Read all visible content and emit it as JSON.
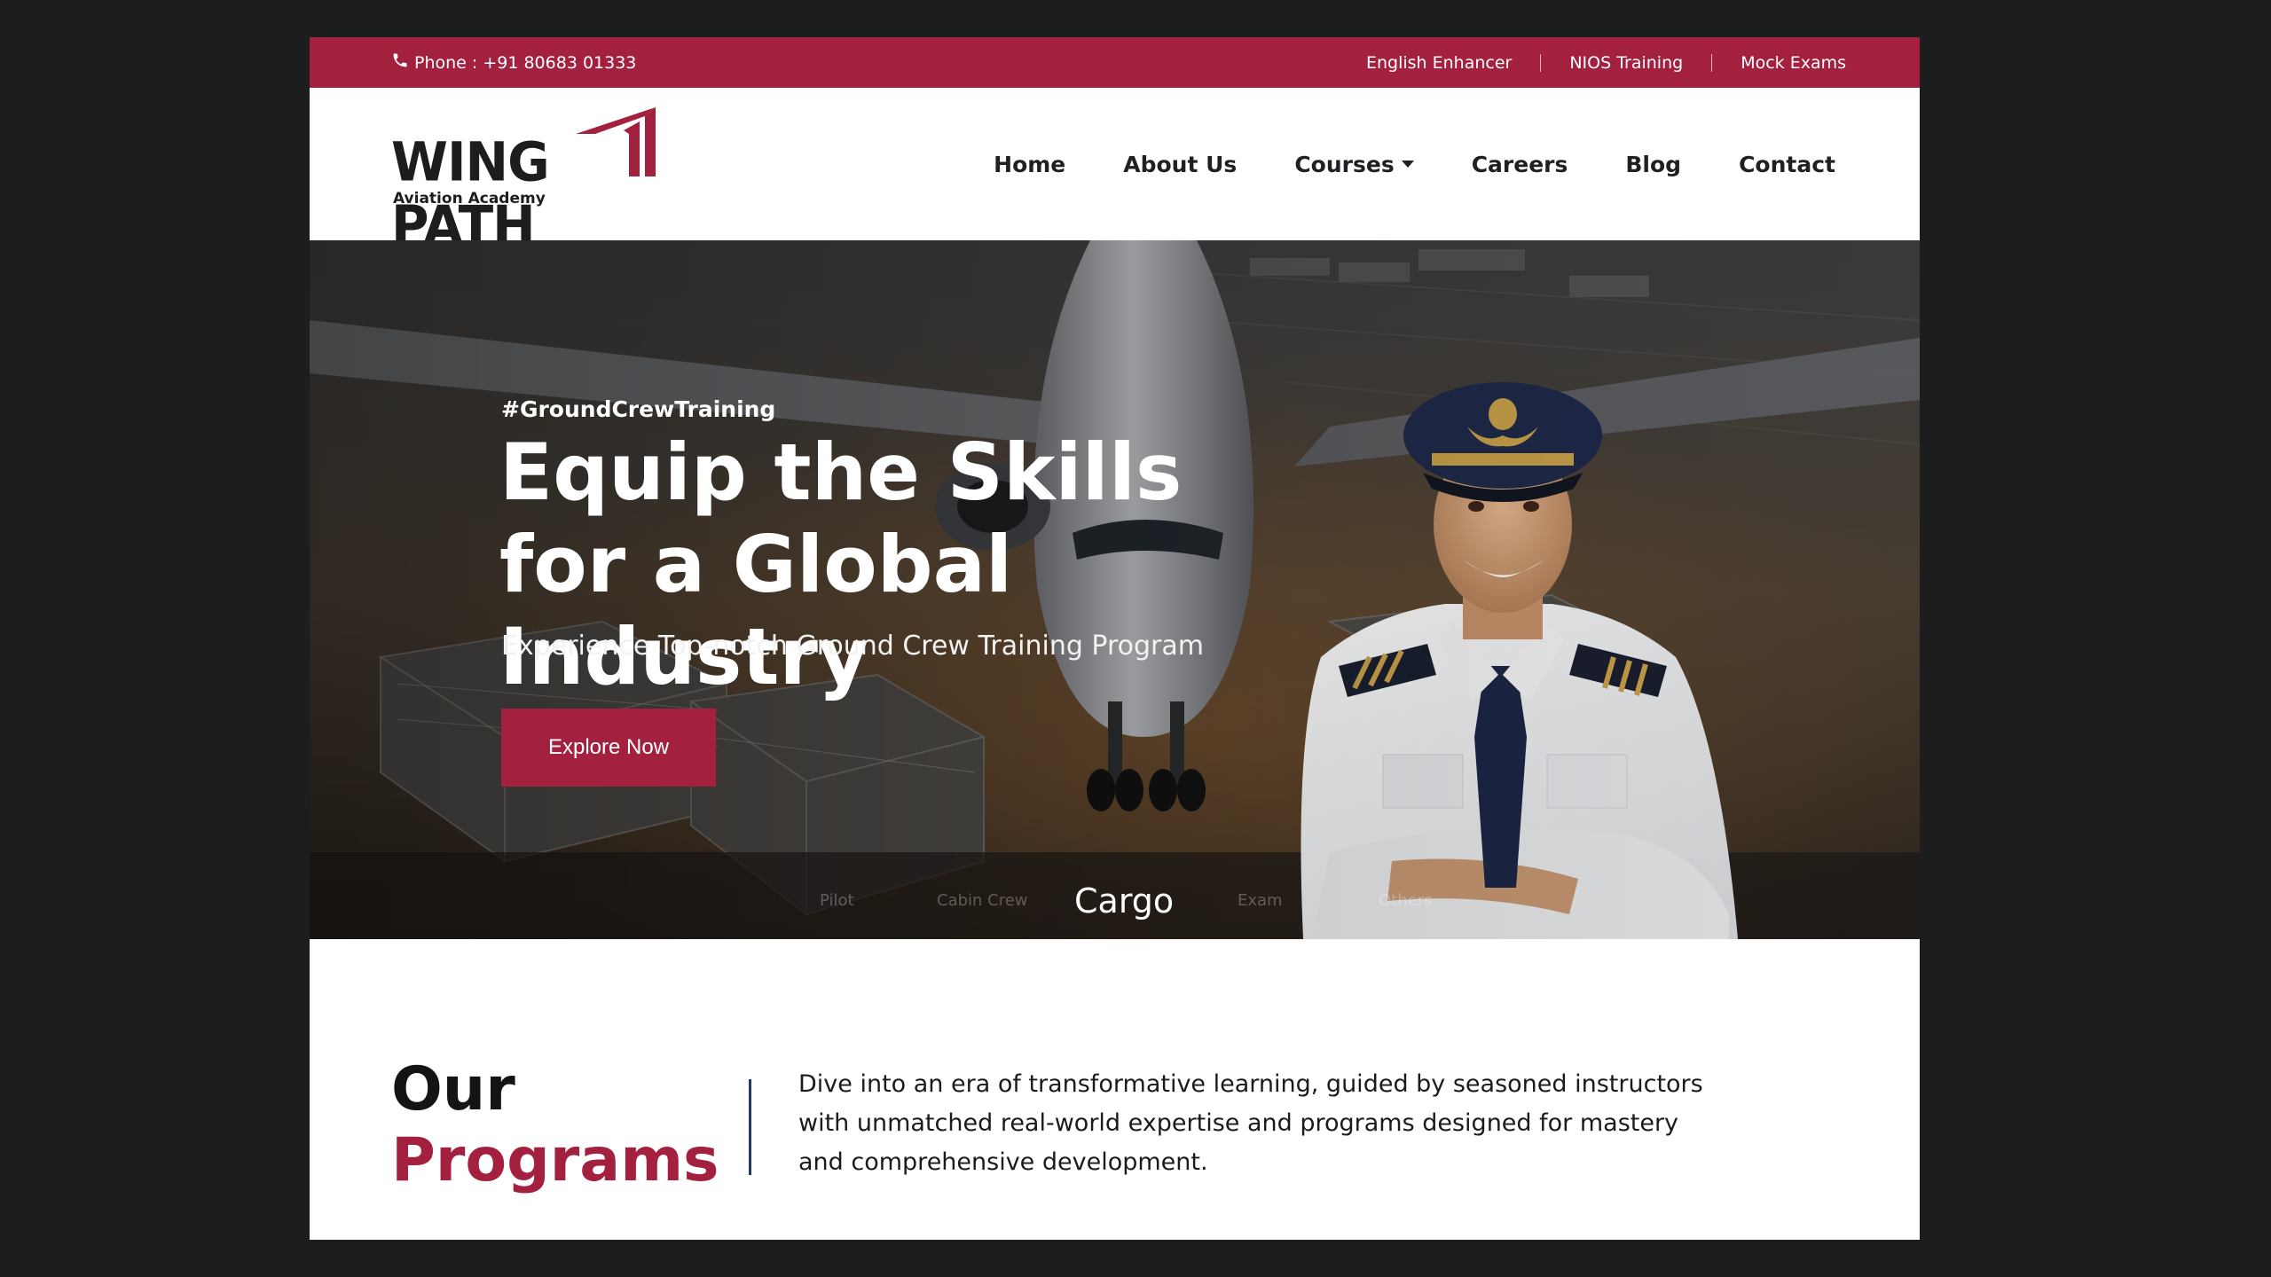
{
  "topbar": {
    "phone_icon": "phone-icon",
    "phone_text": "Phone : +91 80683 01333",
    "links": [
      "English Enhancer",
      "NIOS Training",
      "Mock Exams"
    ]
  },
  "logo": {
    "wordmark": "WING PATH",
    "subtitle": "Aviation Academy"
  },
  "nav": {
    "items": [
      "Home",
      "About Us",
      "Courses",
      "Careers",
      "Blog",
      "Contact"
    ]
  },
  "hero": {
    "tag": "#GroundCrewTraining",
    "title": "Equip the Skills for a Global Industry",
    "subtitle": "Experience Top-notch Ground Crew Training Program",
    "cta": "Explore Now",
    "slides": [
      "Pilot",
      "Cabin Crew",
      "Cargo",
      "Exam",
      "Others"
    ],
    "active_slide": "Cargo"
  },
  "programs": {
    "title_line1": "Our",
    "title_line2": "Programs",
    "description": "Dive into an era of transformative learning, guided by seasoned instructors with unmatched real-world expertise and programs designed for mastery and comprehensive development."
  },
  "colors": {
    "brand": "#a4203f",
    "dark_text": "#1e2024",
    "divider": "#1f3a66",
    "backdrop": "#1b1d1e"
  }
}
